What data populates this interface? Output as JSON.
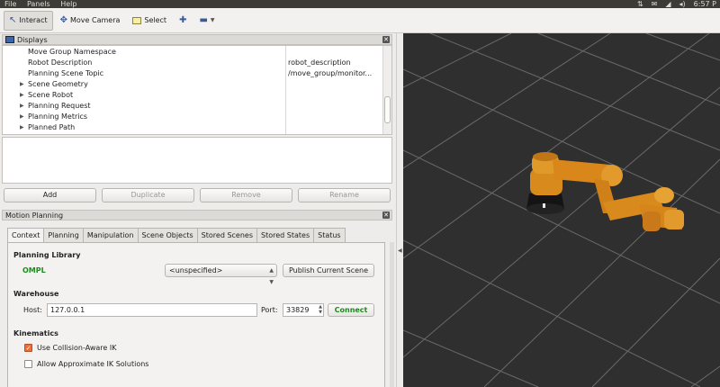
{
  "menubar": {
    "items": [
      "File",
      "Panels",
      "Help"
    ],
    "tray_icons": [
      "swap-arrows-icon",
      "envelope-icon",
      "wifi-icon",
      "speaker-icon"
    ],
    "clock": "6:57 P"
  },
  "toolbar": {
    "interact": "Interact",
    "move_camera": "Move Camera",
    "select": "Select",
    "add_icon": "plus-icon",
    "remove_icon": "minus-icon"
  },
  "displays": {
    "title": "Displays",
    "rows": [
      {
        "name": "Move Group Namespace",
        "value": "",
        "expand": false
      },
      {
        "name": "Robot Description",
        "value": "robot_description",
        "expand": false
      },
      {
        "name": "Planning Scene Topic",
        "value": "/move_group/monitor...",
        "expand": false
      },
      {
        "name": "Scene Geometry",
        "value": "",
        "expand": true
      },
      {
        "name": "Scene Robot",
        "value": "",
        "expand": true
      },
      {
        "name": "Planning Request",
        "value": "",
        "expand": true
      },
      {
        "name": "Planning Metrics",
        "value": "",
        "expand": true
      },
      {
        "name": "Planned Path",
        "value": "",
        "expand": true
      }
    ],
    "buttons": {
      "add": "Add",
      "duplicate": "Duplicate",
      "remove": "Remove",
      "rename": "Rename"
    }
  },
  "motion_planning": {
    "title": "Motion Planning",
    "tabs": [
      "Context",
      "Planning",
      "Manipulation",
      "Scene Objects",
      "Stored Scenes",
      "Stored States",
      "Status"
    ],
    "planning_library": {
      "heading": "Planning Library",
      "library": "OMPL",
      "planner": "<unspecified>",
      "publish": "Publish Current Scene"
    },
    "warehouse": {
      "heading": "Warehouse",
      "host_label": "Host:",
      "host": "127.0.0.1",
      "port_label": "Port:",
      "port": "33829",
      "connect": "Connect"
    },
    "kinematics": {
      "heading": "Kinematics",
      "collision_aware": "Use Collision-Aware IK",
      "collision_aware_checked": true,
      "approx_ik": "Allow Approximate IK Solutions",
      "approx_ik_checked": false
    }
  },
  "colors": {
    "robot_orange": "#d98a1c",
    "robot_base": "#1a1a1a",
    "grid_line": "#6a6a6a",
    "viewport_bg": "#2f2f2f",
    "connect_green": "#1f8a1f"
  }
}
